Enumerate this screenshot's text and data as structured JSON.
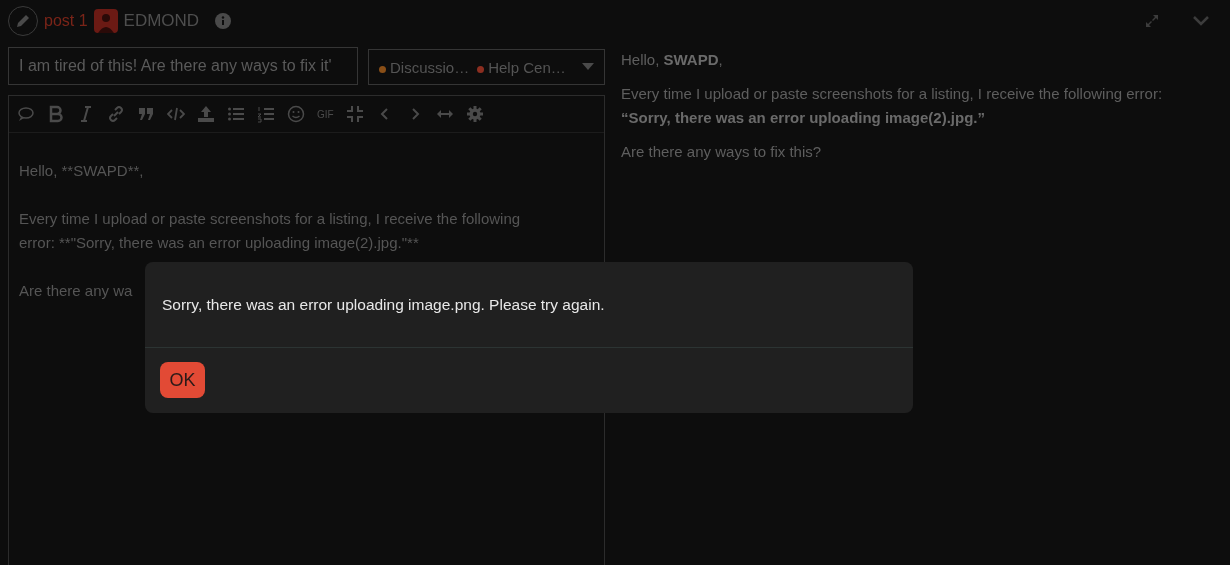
{
  "header": {
    "post_label": "post 1",
    "username": "EDMOND"
  },
  "composer": {
    "title_value": "I am tired of this! Are there any ways to fix it'",
    "categories": [
      {
        "name": "Discussio…",
        "color": "#8a4f17"
      },
      {
        "name": "Help Cen…",
        "color": "#8c2e20"
      }
    ],
    "toolbar_gif": "GIF",
    "editor_paragraphs": [
      [
        "Hello, **SWAPD**,"
      ],
      [
        "Every time I upload or paste screenshots for a listing, I receive the following",
        "error: **\"Sorry, there was an error uploading image(2).jpg.\"**"
      ],
      [
        "Are there any wa"
      ]
    ]
  },
  "preview": {
    "paragraphs": [
      "Hello, **SWAPD**,",
      "Every time I upload or paste screenshots for a listing, I receive the following error: **“Sorry, there was an error uploading image(2).jpg.”**",
      "Are there any ways to fix this?"
    ]
  },
  "dialog": {
    "message": "Sorry, there was an error uploading image.png. Please try again.",
    "button": "OK"
  }
}
